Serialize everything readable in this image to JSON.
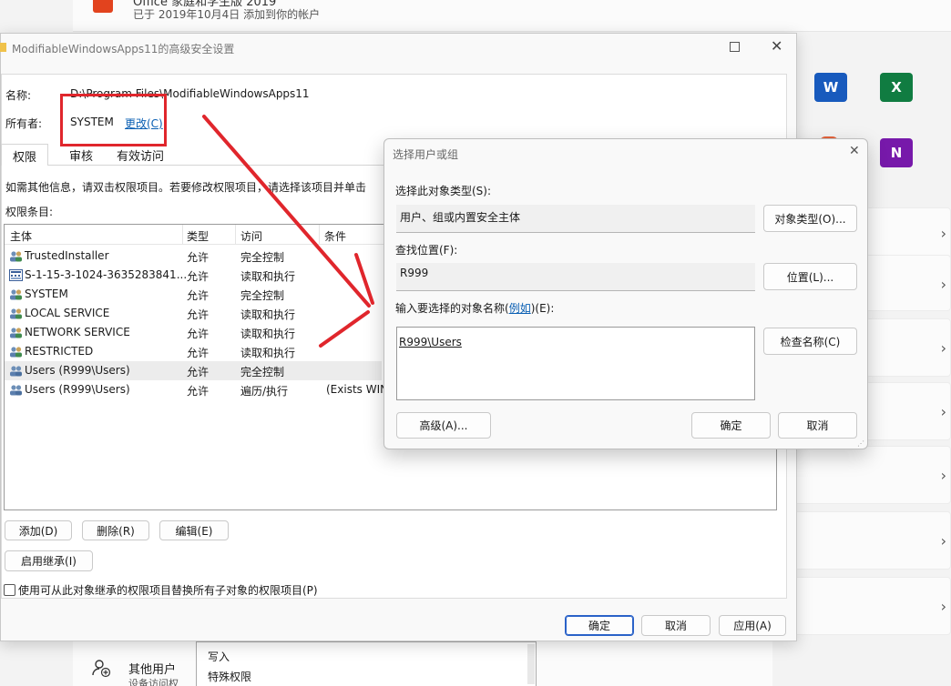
{
  "background": {
    "office_entry_title": "Office 家庭和学生版 2019",
    "office_entry_subtitle": "已于 2019年10月4日 添加到你的帐户",
    "other_users_label": "其他用户",
    "other_users_sub": "设备访问权",
    "perm_list": [
      "写入",
      "特殊权限"
    ],
    "apps": [
      {
        "name": "word-icon",
        "letter": "W",
        "color": "#185abd"
      },
      {
        "name": "excel-icon",
        "letter": "X",
        "color": "#107c41"
      },
      {
        "name": "onenote-icon",
        "letter": "N",
        "color": "#7719aa"
      }
    ]
  },
  "main_dialog": {
    "title": "ModifiableWindowsApps11的高级安全设置",
    "name_label": "名称:",
    "name_value": "D:\\Program Files\\ModifiableWindowsApps11",
    "owner_label": "所有者:",
    "owner_value": "SYSTEM",
    "owner_change_link": "更改(C)",
    "tabs": [
      "权限",
      "审核",
      "有效访问"
    ],
    "info_text": "如需其他信息，请双击权限项目。若要修改权限项目，请选择该项目并单击",
    "entries_label": "权限条目:",
    "columns": [
      "主体",
      "类型",
      "访问",
      "条件"
    ],
    "rows": [
      {
        "principal": "TrustedInstaller",
        "type": "允许",
        "access": "完全控制",
        "condition": ""
      },
      {
        "principal": "S-1-15-3-1024-3635283841...",
        "type": "允许",
        "access": "读取和执行",
        "condition": ""
      },
      {
        "principal": "SYSTEM",
        "type": "允许",
        "access": "完全控制",
        "condition": ""
      },
      {
        "principal": "LOCAL SERVICE",
        "type": "允许",
        "access": "读取和执行",
        "condition": ""
      },
      {
        "principal": "NETWORK SERVICE",
        "type": "允许",
        "access": "读取和执行",
        "condition": ""
      },
      {
        "principal": "RESTRICTED",
        "type": "允许",
        "access": "读取和执行",
        "condition": ""
      },
      {
        "principal": "Users (R999\\Users)",
        "type": "允许",
        "access": "完全控制",
        "condition": ""
      },
      {
        "principal": "Users (R999\\Users)",
        "type": "允许",
        "access": "遍历/执行",
        "condition": "(Exists WIN"
      }
    ],
    "add_button": "添加(D)",
    "remove_button": "删除(R)",
    "edit_button": "编辑(E)",
    "inherit_button": "启用继承(I)",
    "replace_checkbox_label": "使用可从此对象继承的权限项目替换所有子对象的权限项目(P)",
    "ok_button": "确定",
    "cancel_button": "取消",
    "apply_button": "应用(A)"
  },
  "select_dialog": {
    "title": "选择用户或组",
    "object_type_label": "选择此对象类型(S):",
    "object_type_value": "用户、组或内置安全主体",
    "object_type_button": "对象类型(O)...",
    "location_label": "查找位置(F):",
    "location_value": "R999",
    "location_button": "位置(L)...",
    "enter_names_prefix": "输入要选择的对象名称(",
    "enter_names_link": "例如",
    "enter_names_suffix": ")(E):",
    "names_value": "R999\\Users",
    "check_names_button": "检查名称(C)",
    "advanced_button": "高级(A)...",
    "ok_button": "确定",
    "cancel_button": "取消"
  },
  "annotation_color": "#e0262c"
}
